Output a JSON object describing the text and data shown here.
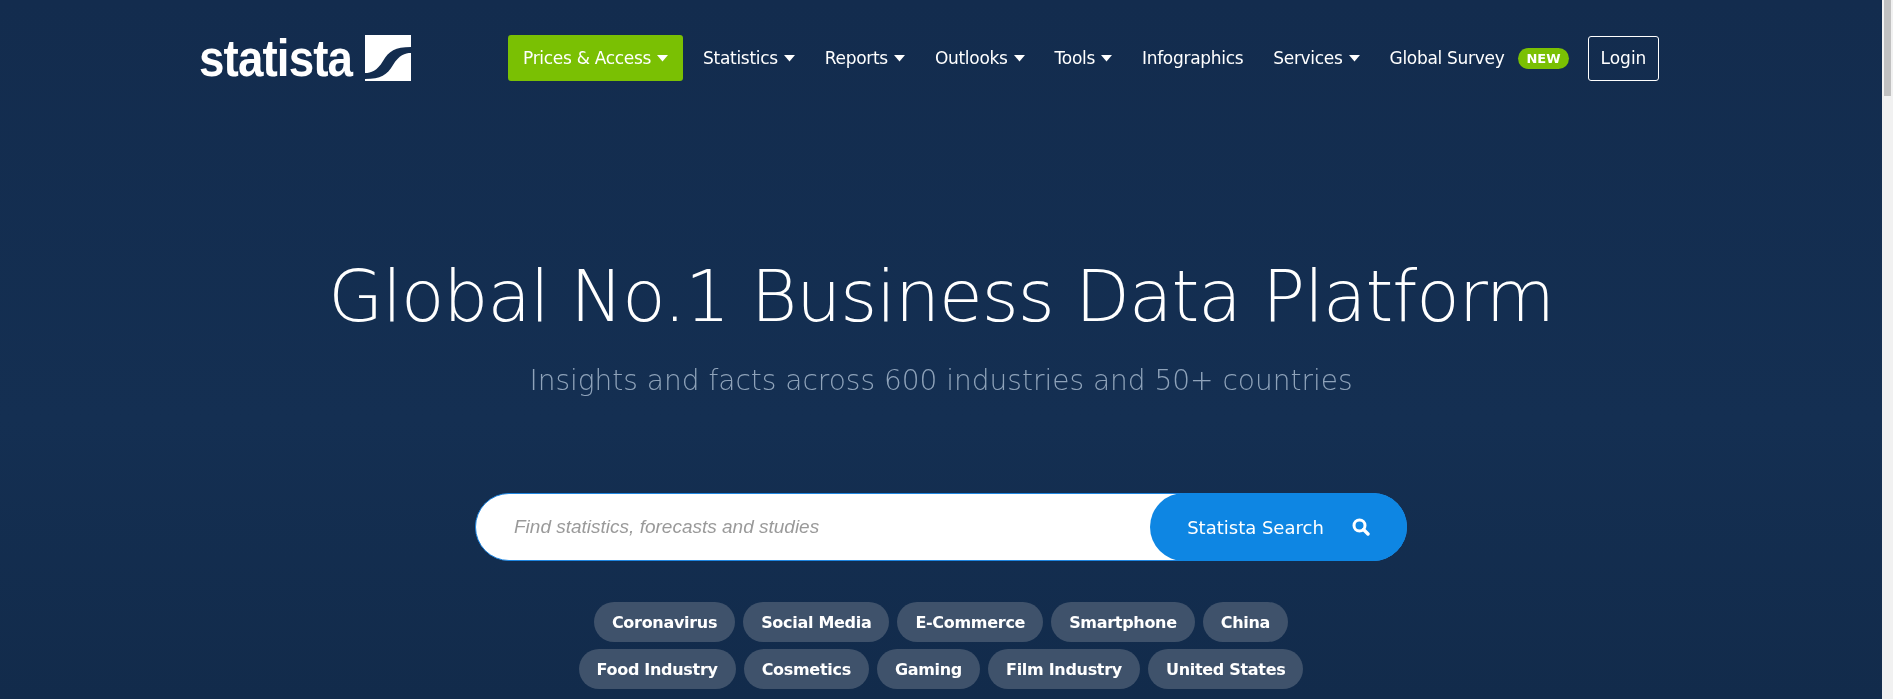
{
  "header": {
    "logo": "statista",
    "nav": [
      {
        "label": "Prices & Access",
        "dropdown": true,
        "highlighted": true
      },
      {
        "label": "Statistics",
        "dropdown": true,
        "highlighted": false
      },
      {
        "label": "Reports",
        "dropdown": true,
        "highlighted": false
      },
      {
        "label": "Outlooks",
        "dropdown": true,
        "highlighted": false
      },
      {
        "label": "Tools",
        "dropdown": true,
        "highlighted": false
      },
      {
        "label": "Infographics",
        "dropdown": false,
        "highlighted": false
      },
      {
        "label": "Services",
        "dropdown": true,
        "highlighted": false
      },
      {
        "label": "Global Survey",
        "dropdown": false,
        "highlighted": false,
        "badge": "NEW"
      }
    ],
    "login": "Login"
  },
  "hero": {
    "title": "Global No.1 Business Data Platform",
    "subtitle": "Insights and facts across 600 industries and 50+ countries"
  },
  "search": {
    "placeholder": "Find statistics, forecasts and studies",
    "button": "Statista Search"
  },
  "topics": [
    [
      "Coronavirus",
      "Social Media",
      "E-Commerce",
      "Smartphone",
      "China"
    ],
    [
      "Food Industry",
      "Cosmetics",
      "Gaming",
      "Film Industry",
      "United States"
    ]
  ]
}
